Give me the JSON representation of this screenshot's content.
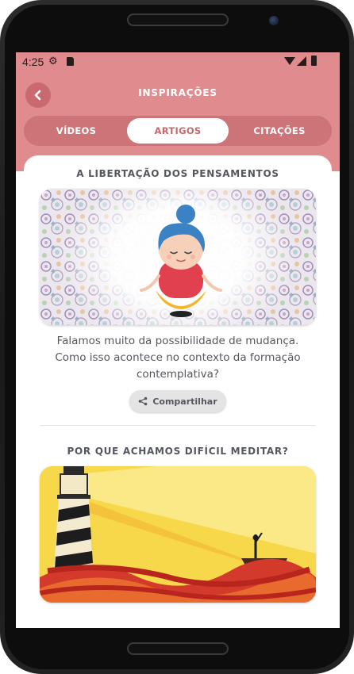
{
  "status_bar": {
    "time": "4:25",
    "icons": [
      "settings-gear-icon",
      "sd-card-icon",
      "wifi-icon",
      "signal-icon",
      "battery-icon"
    ]
  },
  "header": {
    "title": "INSPIRAÇÕES",
    "back_icon": "chevron-left-icon",
    "background_color": "#e08b8e"
  },
  "tabs": [
    {
      "label": "VÍDEOS",
      "active": false
    },
    {
      "label": "ARTIGOS",
      "active": true
    },
    {
      "label": "CITAÇÕES",
      "active": false
    }
  ],
  "articles": [
    {
      "title": "A LIBERTAÇÃO DOS PENSAMENTOS",
      "image": "meditating-woman-illustration",
      "description": "Falamos muito da possibilidade de mudança. Como isso acontece no contexto da formação contemplativa?",
      "share_label": "Compartilhar",
      "share_icon": "share-icon"
    },
    {
      "title": "POR QUE ACHAMOS DIFÍCIL MEDITAR?",
      "image": "lighthouse-boat-illustration"
    }
  ],
  "colors": {
    "accent": "#e08b8e",
    "accent_dark": "#cc7478",
    "active_tab_text": "#c9676c",
    "text": "#56575e"
  }
}
